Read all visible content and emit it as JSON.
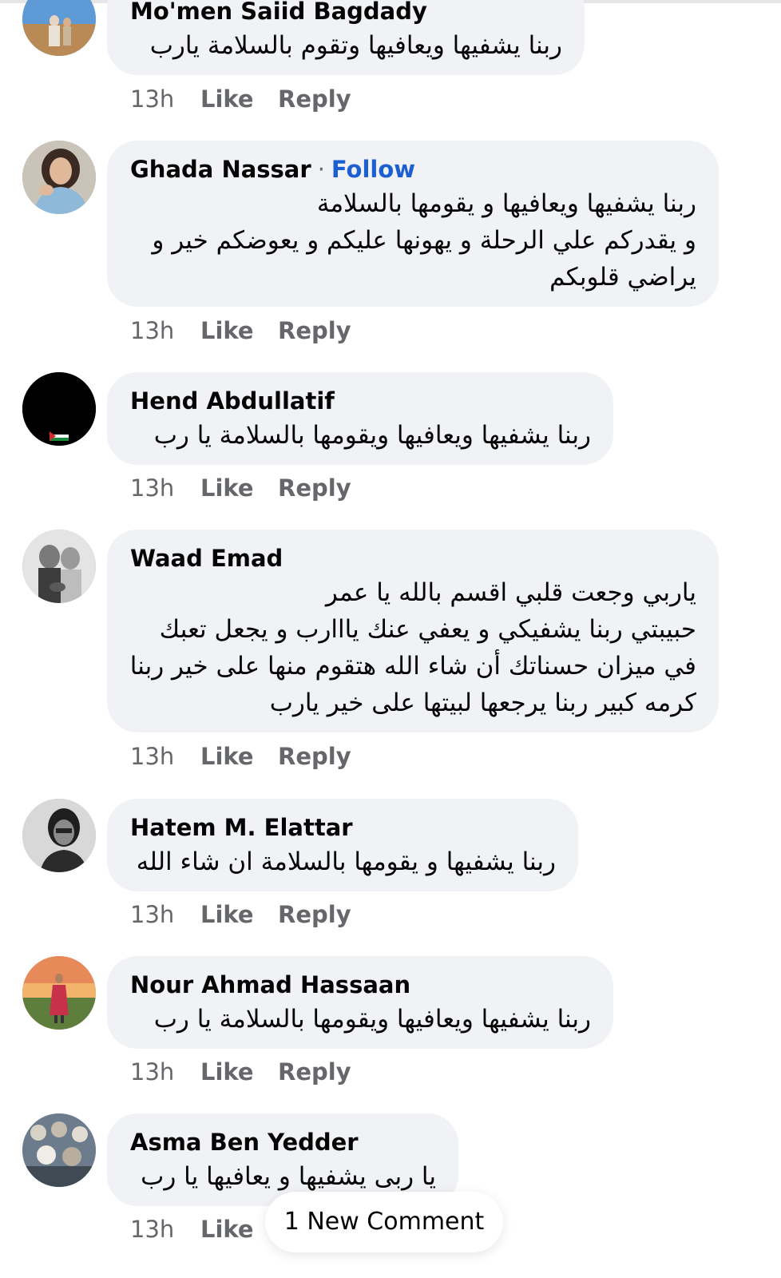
{
  "comments": [
    {
      "author": "Mo'men Saiid Bagdady",
      "follow": "",
      "text": [
        "ربنا يشفيها ويعافيها وتقوم بالسلامة يارب"
      ],
      "time": "13h",
      "like": "Like",
      "reply": "Reply"
    },
    {
      "author": "Ghada Nassar",
      "separator": "·",
      "follow": "Follow",
      "text": [
        "ربنا يشفيها ويعافيها و يقومها بالسلامة",
        "و يقدركم علي الرحلة و يهونها عليكم و يعوضكم خير و",
        "يراضي قلوبكم"
      ],
      "time": "13h",
      "like": "Like",
      "reply": "Reply"
    },
    {
      "author": "Hend Abdullatif",
      "follow": "",
      "text": [
        "ربنا يشفيها ويعافيها ويقومها بالسلامة يا رب"
      ],
      "time": "13h",
      "like": "Like",
      "reply": "Reply"
    },
    {
      "author": "Waad Emad",
      "follow": "",
      "text": [
        "ياربي وجعت قلبي اقسم بالله يا عمر",
        "حبيبتي ربنا يشفيكي و يعفي عنك يااارب و يجعل تعبك",
        "في ميزان حسناتك أن شاء الله هتقوم منها على خير ربنا",
        "كرمه كبير ربنا يرجعها لبيتها على خير يارب"
      ],
      "time": "13h",
      "like": "Like",
      "reply": "Reply"
    },
    {
      "author": "Hatem M. Elattar",
      "follow": "",
      "text": [
        "ربنا يشفيها و يقومها بالسلامة ان شاء الله"
      ],
      "time": "13h",
      "like": "Like",
      "reply": "Reply"
    },
    {
      "author": "Nour Ahmad Hassaan",
      "follow": "",
      "text": [
        "ربنا يشفيها ويعافيها ويقومها بالسلامة يا رب"
      ],
      "time": "13h",
      "like": "Like",
      "reply": "Reply"
    },
    {
      "author": "Asma Ben Yedder",
      "follow": "",
      "text": [
        "يا ربى يشفيها و يعافيها يا رب"
      ],
      "time": "13h",
      "like": "Like",
      "reply": ""
    }
  ],
  "new_comment_pill": "1 New Comment",
  "colors": {
    "bubble": "#f0f2f5",
    "follow": "#1b5fd1",
    "meta": "#65676b"
  }
}
